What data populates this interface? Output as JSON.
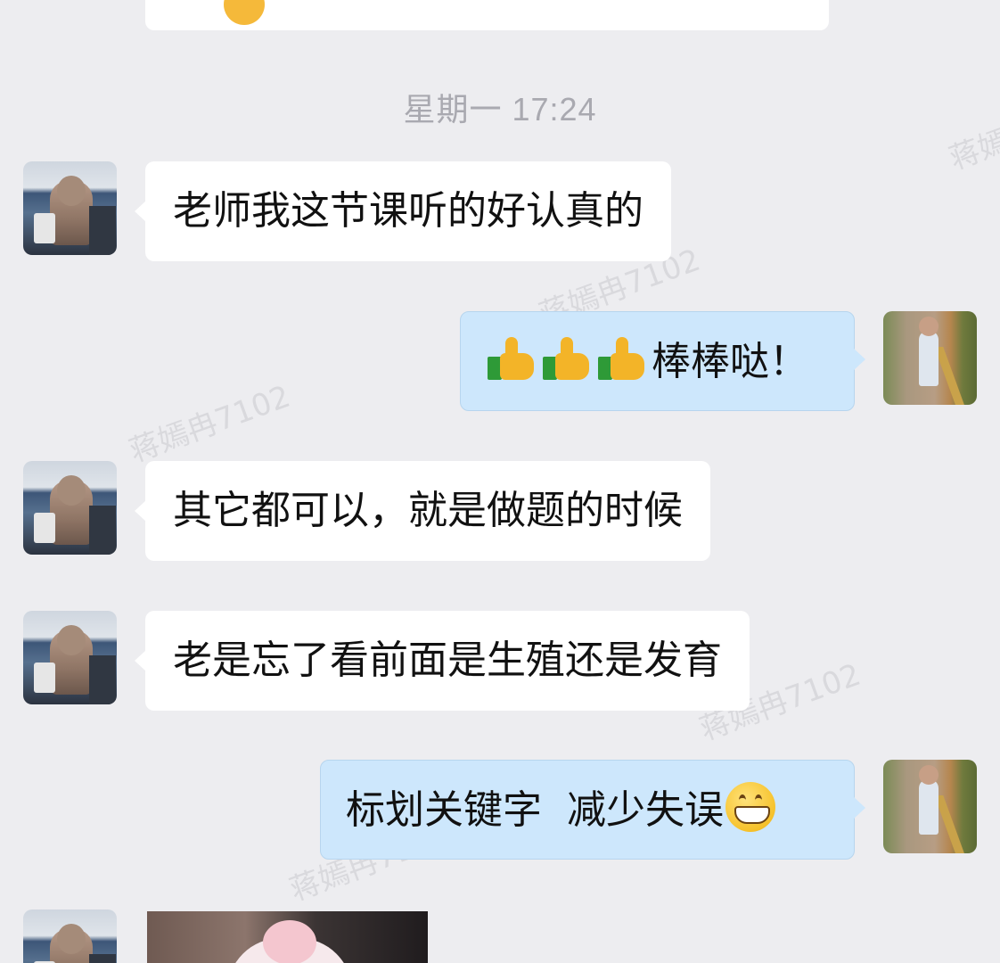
{
  "timestamp": "星期一 17:24",
  "watermark": "蒋嫣冉7102",
  "messages": [
    {
      "side": "in",
      "text": "老师我这节课听的好认真的"
    },
    {
      "side": "out",
      "emoji": [
        "thumbs-up",
        "thumbs-up",
        "thumbs-up"
      ],
      "text": "棒棒哒！"
    },
    {
      "side": "in",
      "text": "其它都可以，就是做题的时候"
    },
    {
      "side": "in",
      "text": "老是忘了看前面是生殖还是发育"
    },
    {
      "side": "out",
      "text": "标划关键字  减少失误",
      "emoji_after": "grinning-face"
    },
    {
      "side": "in",
      "type": "image"
    }
  ],
  "colors": {
    "background": "#ededf0",
    "incoming_bubble": "#ffffff",
    "outgoing_bubble": "#cde7fc",
    "timestamp_text": "#a9a9b0"
  }
}
